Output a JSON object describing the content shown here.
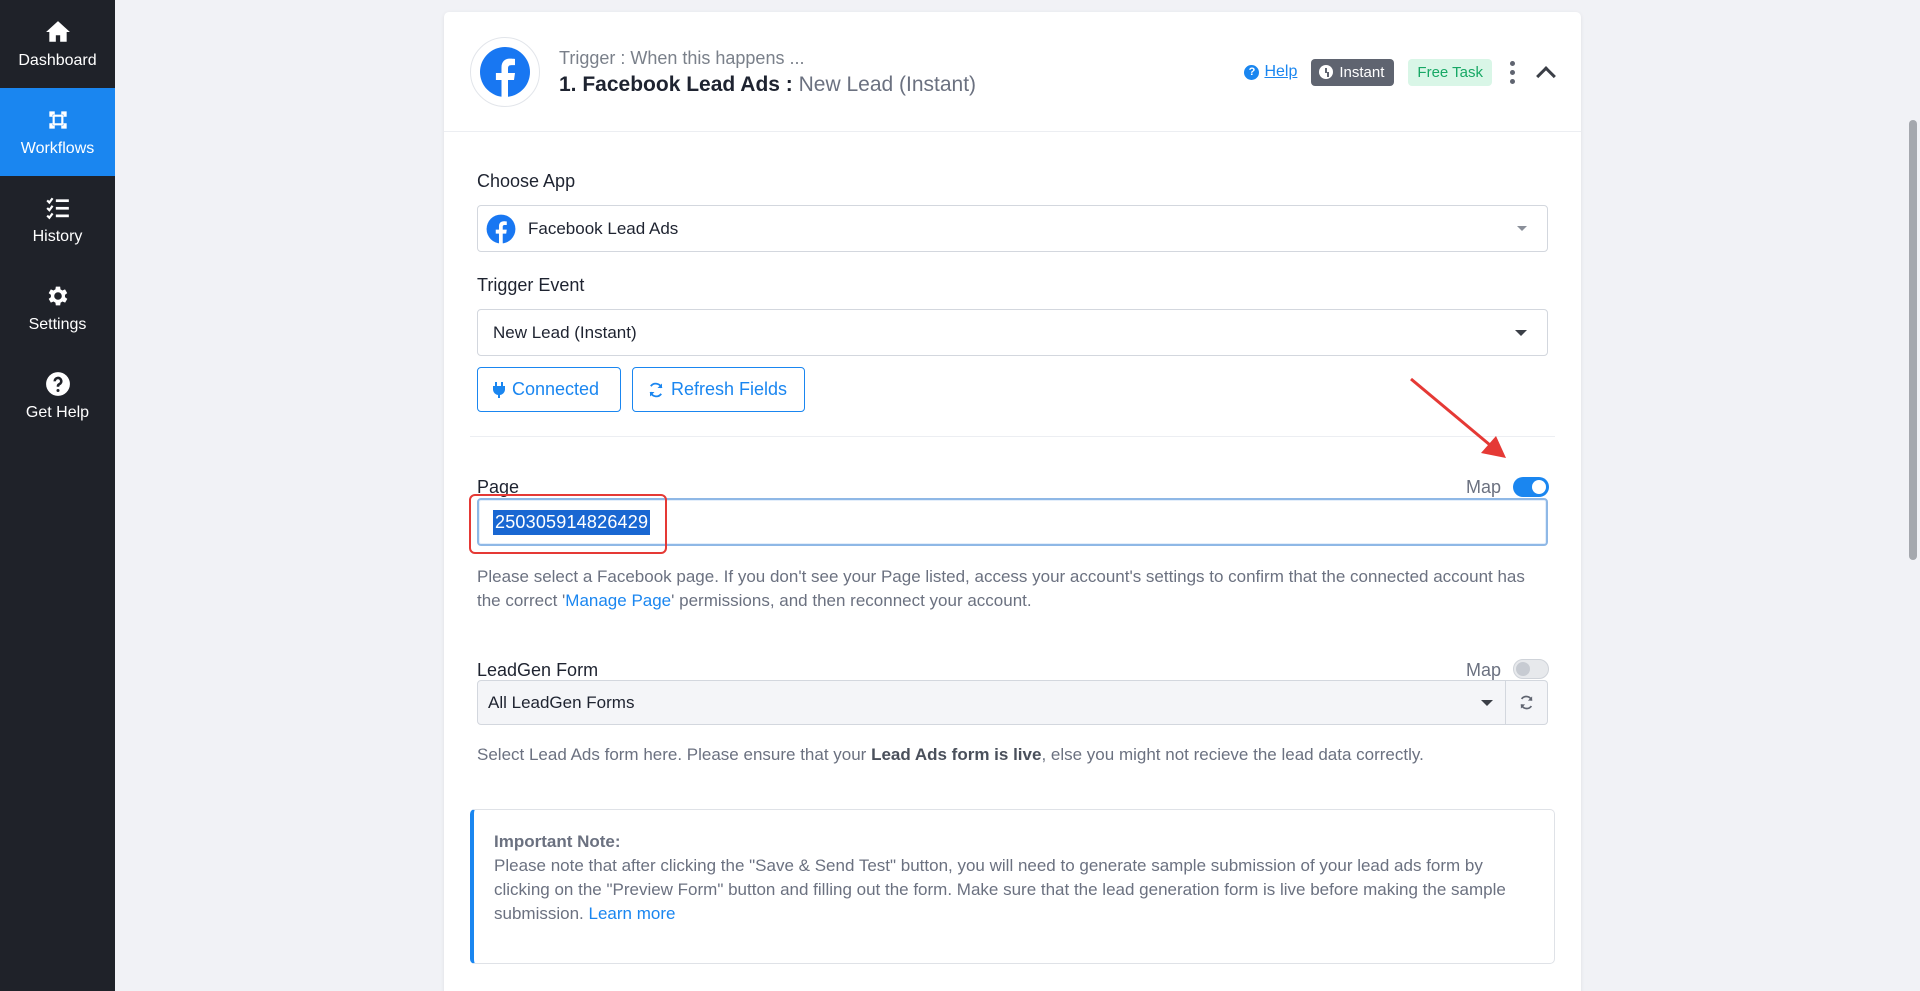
{
  "sidebar": {
    "items": [
      {
        "label": "Dashboard",
        "icon": "home-icon"
      },
      {
        "label": "Workflows",
        "icon": "workflows-icon",
        "active": true
      },
      {
        "label": "History",
        "icon": "list-check-icon"
      },
      {
        "label": "Settings",
        "icon": "gear-icon"
      },
      {
        "label": "Get Help",
        "icon": "question-circle-icon"
      }
    ]
  },
  "trigger": {
    "caption": "Trigger : When this happens ...",
    "title_app": "1. Facebook Lead Ads :",
    "title_event": "New Lead (Instant)",
    "help_label": "Help",
    "instant_label": "Instant",
    "free_task_label": "Free Task"
  },
  "form": {
    "choose_app_label": "Choose App",
    "choose_app_value": "Facebook Lead Ads",
    "trigger_event_label": "Trigger Event",
    "trigger_event_value": "New Lead (Instant)",
    "connected_label": "Connected",
    "refresh_fields_label": "Refresh Fields",
    "page_label": "Page",
    "map_label": "Map",
    "page_value": "250305914826429",
    "page_help_part1": "Please select a Facebook page. If you don't see your Page listed, access your account's settings to confirm that the connected account has the correct '",
    "page_help_link": "Manage Page",
    "page_help_part2": "' permissions, and then reconnect your account.",
    "leadgen_label": "LeadGen Form",
    "leadgen_map_label": "Map",
    "leadgen_value": "All LeadGen Forms",
    "leadgen_help_part1": "Select Lead Ads form here. Please ensure that your ",
    "leadgen_help_bold": "Lead Ads form is live",
    "leadgen_help_part2": ", else you might not recieve the lead data correctly."
  },
  "note": {
    "title": "Important Note:",
    "body": "Please note that after clicking the \"Save & Send Test\" button, you will need to generate sample submission of your lead ads form by clicking on the \"Preview Form\" button and filling out the form. Make sure that the lead generation form is live before making the sample submission.",
    "link": "Learn more"
  },
  "colors": {
    "sidebar_bg": "#1f2229",
    "accent": "#1a86f0",
    "annotation_red": "#e53935"
  }
}
